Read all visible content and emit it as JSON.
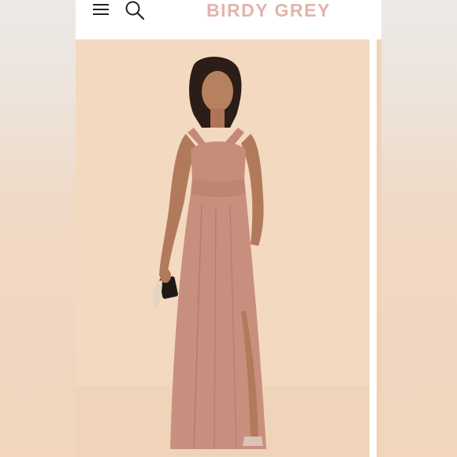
{
  "header": {
    "brand": "BIRDY GREY",
    "icons": [
      "menu-icon",
      "search-icon"
    ]
  },
  "colors": {
    "brand": "#e2b3ac",
    "backdrop": "#f3d9bf",
    "dress": "#c98f7e",
    "header_bg": "#ffffff"
  },
  "product": {
    "image_subject": "dress-model-photo"
  }
}
